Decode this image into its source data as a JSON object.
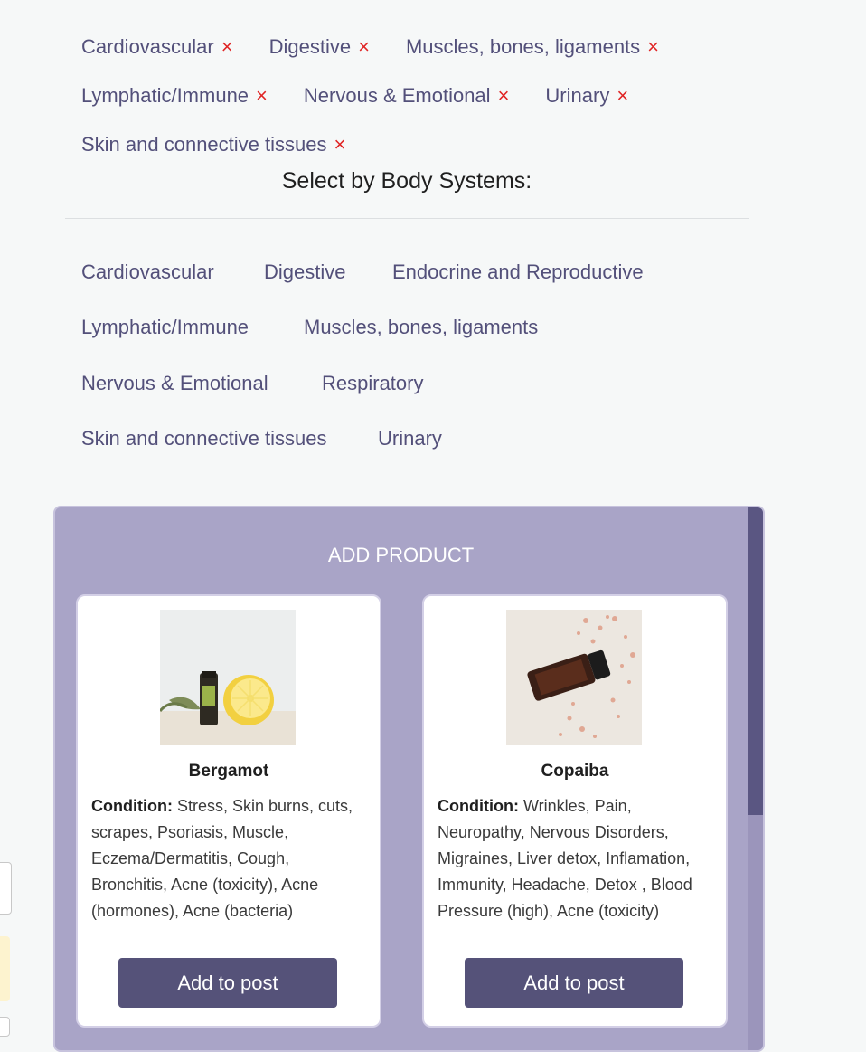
{
  "selected": {
    "rows": [
      [
        "Cardiovascular",
        "Digestive",
        "Muscles, bones, ligaments"
      ],
      [
        "Lymphatic/Immune",
        "Nervous & Emotional",
        "Urinary"
      ],
      [
        "Skin and connective tissues"
      ]
    ],
    "remove_symbol": "×"
  },
  "section_title": "Select by Body Systems:",
  "options": [
    "Cardiovascular",
    "Digestive",
    "Endocrine and Reproductive",
    "Lymphatic/Immune",
    "Muscles, bones, ligaments",
    "Nervous & Emotional",
    "Respiratory",
    "Skin and connective tissues",
    "Urinary"
  ],
  "panel": {
    "title": "ADD PRODUCT",
    "condition_label": "Condition:",
    "button_label": "Add to post",
    "products": [
      {
        "name": "Bergamot",
        "condition": "Stress, Skin burns, cuts, scrapes, Psoriasis, Muscle, Eczema/Dermatitis, Cough, Bronchitis, Acne (toxicity), Acne (hormones), Acne (bacteria)"
      },
      {
        "name": "Copaiba",
        "condition": "Wrinkles, Pain, Neuropathy, Nervous Disorders, Migraines, Liver detox, Inflamation, Immunity, Headache, Detox , Blood Pressure (high), Acne (toxicity)"
      }
    ]
  },
  "colors": {
    "remove_x": "#e02424",
    "panel_bg": "#a9a4c7",
    "button_bg": "#555279",
    "chip_text": "#53507a"
  }
}
